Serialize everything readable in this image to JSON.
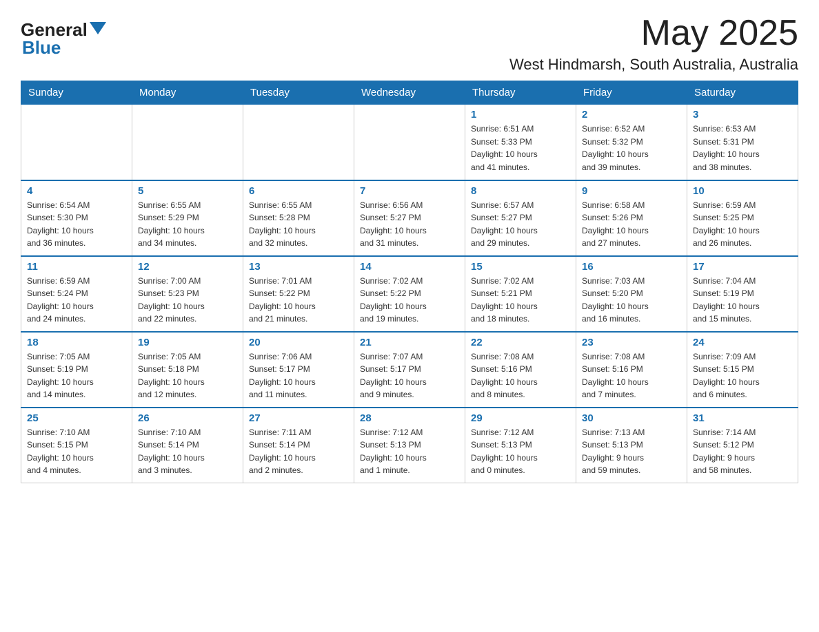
{
  "header": {
    "logo_general": "General",
    "logo_blue": "Blue",
    "month_year": "May 2025",
    "location": "West Hindmarsh, South Australia, Australia"
  },
  "weekdays": [
    "Sunday",
    "Monday",
    "Tuesday",
    "Wednesday",
    "Thursday",
    "Friday",
    "Saturday"
  ],
  "weeks": [
    [
      {
        "day": "",
        "info": ""
      },
      {
        "day": "",
        "info": ""
      },
      {
        "day": "",
        "info": ""
      },
      {
        "day": "",
        "info": ""
      },
      {
        "day": "1",
        "info": "Sunrise: 6:51 AM\nSunset: 5:33 PM\nDaylight: 10 hours\nand 41 minutes."
      },
      {
        "day": "2",
        "info": "Sunrise: 6:52 AM\nSunset: 5:32 PM\nDaylight: 10 hours\nand 39 minutes."
      },
      {
        "day": "3",
        "info": "Sunrise: 6:53 AM\nSunset: 5:31 PM\nDaylight: 10 hours\nand 38 minutes."
      }
    ],
    [
      {
        "day": "4",
        "info": "Sunrise: 6:54 AM\nSunset: 5:30 PM\nDaylight: 10 hours\nand 36 minutes."
      },
      {
        "day": "5",
        "info": "Sunrise: 6:55 AM\nSunset: 5:29 PM\nDaylight: 10 hours\nand 34 minutes."
      },
      {
        "day": "6",
        "info": "Sunrise: 6:55 AM\nSunset: 5:28 PM\nDaylight: 10 hours\nand 32 minutes."
      },
      {
        "day": "7",
        "info": "Sunrise: 6:56 AM\nSunset: 5:27 PM\nDaylight: 10 hours\nand 31 minutes."
      },
      {
        "day": "8",
        "info": "Sunrise: 6:57 AM\nSunset: 5:27 PM\nDaylight: 10 hours\nand 29 minutes."
      },
      {
        "day": "9",
        "info": "Sunrise: 6:58 AM\nSunset: 5:26 PM\nDaylight: 10 hours\nand 27 minutes."
      },
      {
        "day": "10",
        "info": "Sunrise: 6:59 AM\nSunset: 5:25 PM\nDaylight: 10 hours\nand 26 minutes."
      }
    ],
    [
      {
        "day": "11",
        "info": "Sunrise: 6:59 AM\nSunset: 5:24 PM\nDaylight: 10 hours\nand 24 minutes."
      },
      {
        "day": "12",
        "info": "Sunrise: 7:00 AM\nSunset: 5:23 PM\nDaylight: 10 hours\nand 22 minutes."
      },
      {
        "day": "13",
        "info": "Sunrise: 7:01 AM\nSunset: 5:22 PM\nDaylight: 10 hours\nand 21 minutes."
      },
      {
        "day": "14",
        "info": "Sunrise: 7:02 AM\nSunset: 5:22 PM\nDaylight: 10 hours\nand 19 minutes."
      },
      {
        "day": "15",
        "info": "Sunrise: 7:02 AM\nSunset: 5:21 PM\nDaylight: 10 hours\nand 18 minutes."
      },
      {
        "day": "16",
        "info": "Sunrise: 7:03 AM\nSunset: 5:20 PM\nDaylight: 10 hours\nand 16 minutes."
      },
      {
        "day": "17",
        "info": "Sunrise: 7:04 AM\nSunset: 5:19 PM\nDaylight: 10 hours\nand 15 minutes."
      }
    ],
    [
      {
        "day": "18",
        "info": "Sunrise: 7:05 AM\nSunset: 5:19 PM\nDaylight: 10 hours\nand 14 minutes."
      },
      {
        "day": "19",
        "info": "Sunrise: 7:05 AM\nSunset: 5:18 PM\nDaylight: 10 hours\nand 12 minutes."
      },
      {
        "day": "20",
        "info": "Sunrise: 7:06 AM\nSunset: 5:17 PM\nDaylight: 10 hours\nand 11 minutes."
      },
      {
        "day": "21",
        "info": "Sunrise: 7:07 AM\nSunset: 5:17 PM\nDaylight: 10 hours\nand 9 minutes."
      },
      {
        "day": "22",
        "info": "Sunrise: 7:08 AM\nSunset: 5:16 PM\nDaylight: 10 hours\nand 8 minutes."
      },
      {
        "day": "23",
        "info": "Sunrise: 7:08 AM\nSunset: 5:16 PM\nDaylight: 10 hours\nand 7 minutes."
      },
      {
        "day": "24",
        "info": "Sunrise: 7:09 AM\nSunset: 5:15 PM\nDaylight: 10 hours\nand 6 minutes."
      }
    ],
    [
      {
        "day": "25",
        "info": "Sunrise: 7:10 AM\nSunset: 5:15 PM\nDaylight: 10 hours\nand 4 minutes."
      },
      {
        "day": "26",
        "info": "Sunrise: 7:10 AM\nSunset: 5:14 PM\nDaylight: 10 hours\nand 3 minutes."
      },
      {
        "day": "27",
        "info": "Sunrise: 7:11 AM\nSunset: 5:14 PM\nDaylight: 10 hours\nand 2 minutes."
      },
      {
        "day": "28",
        "info": "Sunrise: 7:12 AM\nSunset: 5:13 PM\nDaylight: 10 hours\nand 1 minute."
      },
      {
        "day": "29",
        "info": "Sunrise: 7:12 AM\nSunset: 5:13 PM\nDaylight: 10 hours\nand 0 minutes."
      },
      {
        "day": "30",
        "info": "Sunrise: 7:13 AM\nSunset: 5:13 PM\nDaylight: 9 hours\nand 59 minutes."
      },
      {
        "day": "31",
        "info": "Sunrise: 7:14 AM\nSunset: 5:12 PM\nDaylight: 9 hours\nand 58 minutes."
      }
    ]
  ]
}
